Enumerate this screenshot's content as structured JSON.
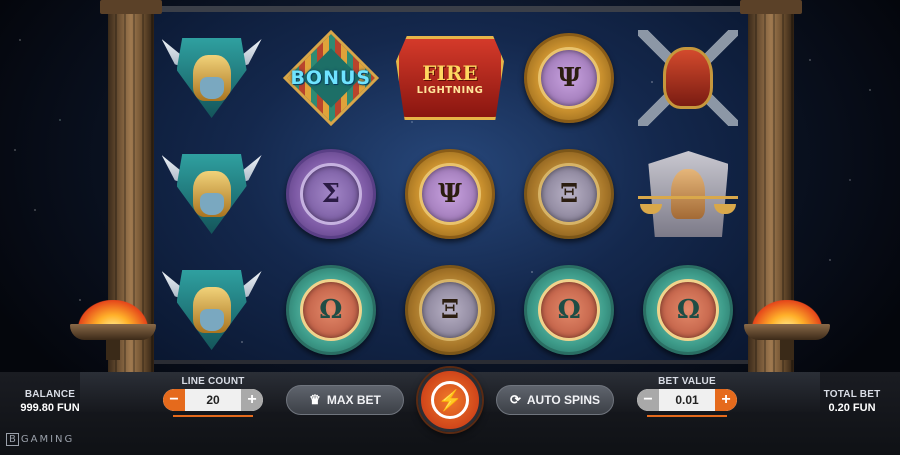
{
  "game": {
    "reels": [
      [
        {
          "symbol": "hero-warrior",
          "glyph": ""
        },
        {
          "symbol": "hero-warrior",
          "glyph": ""
        },
        {
          "symbol": "hero-warrior",
          "glyph": ""
        }
      ],
      [
        {
          "symbol": "bonus",
          "glyph": "BONUS"
        },
        {
          "symbol": "coin-purple",
          "glyph": "Σ"
        },
        {
          "symbol": "coin-teal",
          "glyph": "Ω"
        }
      ],
      [
        {
          "symbol": "fire-lightning",
          "glyph": "FIRE"
        },
        {
          "symbol": "coin-gold",
          "glyph": "Ψ"
        },
        {
          "symbol": "coin-bronze",
          "glyph": "Ξ"
        }
      ],
      [
        {
          "symbol": "coin-gold",
          "glyph": "Ψ"
        },
        {
          "symbol": "coin-bronze",
          "glyph": "Ξ"
        },
        {
          "symbol": "coin-teal",
          "glyph": "Ω"
        }
      ],
      [
        {
          "symbol": "spartan-axes",
          "glyph": ""
        },
        {
          "symbol": "lady-justice",
          "glyph": ""
        },
        {
          "symbol": "coin-teal",
          "glyph": "Ω"
        }
      ]
    ],
    "fire_sub": "LIGHTNING"
  },
  "controls": {
    "balance_label": "BALANCE",
    "balance_value": "999.80 FUN",
    "line_count_label": "LINE COUNT",
    "line_count_value": "20",
    "max_bet_label": "MAX BET",
    "auto_spins_label": "AUTO SPINS",
    "bet_value_label": "BET VALUE",
    "bet_value": "0.01",
    "total_bet_label": "TOTAL BET",
    "total_bet_value": "0.20 FUN",
    "minus": "−",
    "plus": "+"
  },
  "brand": {
    "mark": "B",
    "text": "GAMING"
  },
  "colors": {
    "accent": "#e56a1c",
    "reel_bg": "#14284d"
  },
  "icons": {
    "spin": "lightning-icon",
    "max_bet": "crown-icon",
    "auto": "auto-cycle-icon"
  }
}
